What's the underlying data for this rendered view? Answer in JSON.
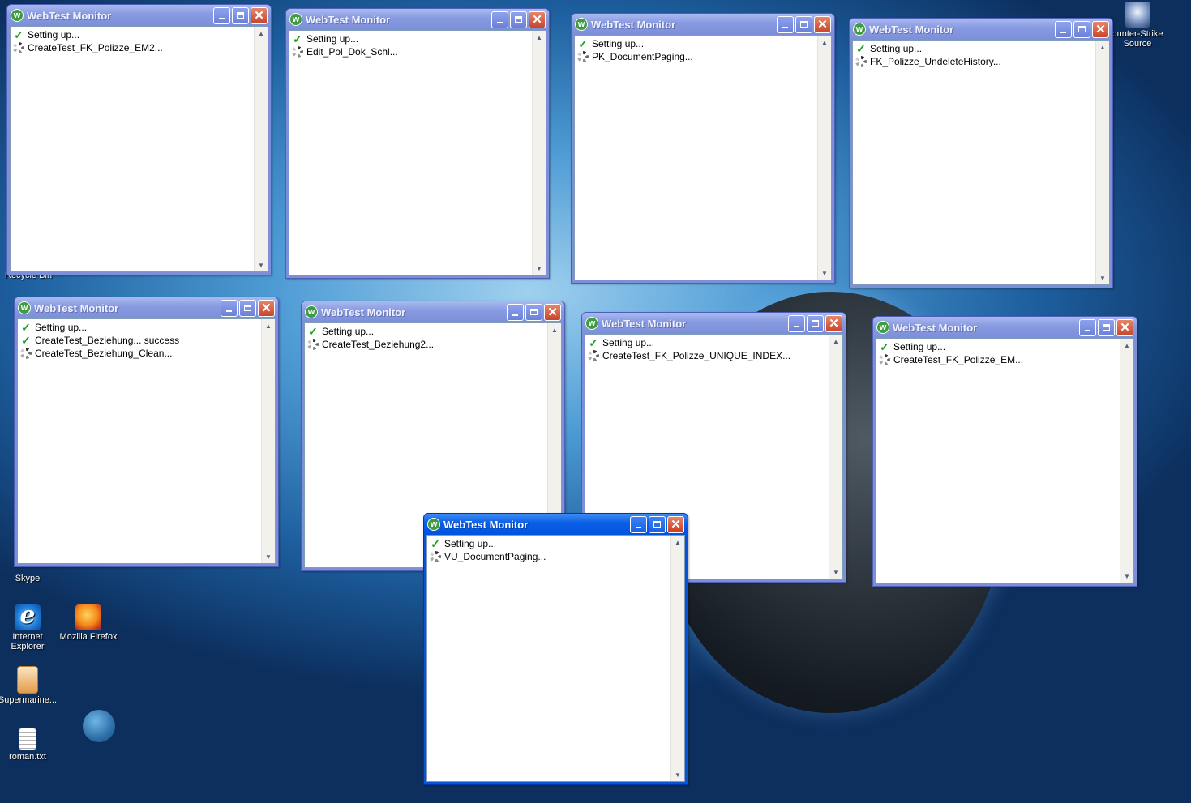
{
  "desktop": {
    "icons": [
      {
        "label": "Skype"
      },
      {
        "label": "Internet Explorer"
      },
      {
        "label": "Mozilla Firefox"
      },
      {
        "label": "Supermarine..."
      },
      {
        "label": "roman.txt"
      },
      {
        "label": "ounter-Strike Source"
      },
      {
        "label": "Recycle Bin"
      }
    ]
  },
  "windows": [
    {
      "title": "WebTest Monitor",
      "active": false,
      "rows": [
        {
          "status": "done",
          "text": "Setting up..."
        },
        {
          "status": "running",
          "text": "CreateTest_FK_Polizze_EM2..."
        }
      ]
    },
    {
      "title": "WebTest Monitor",
      "active": false,
      "rows": [
        {
          "status": "done",
          "text": "Setting up..."
        },
        {
          "status": "running",
          "text": "Edit_Pol_Dok_Schl..."
        }
      ]
    },
    {
      "title": "WebTest Monitor",
      "active": false,
      "rows": [
        {
          "status": "done",
          "text": "Setting up..."
        },
        {
          "status": "running",
          "text": "PK_DocumentPaging..."
        }
      ]
    },
    {
      "title": "WebTest Monitor",
      "active": false,
      "rows": [
        {
          "status": "done",
          "text": "Setting up..."
        },
        {
          "status": "running",
          "text": "FK_Polizze_UndeleteHistory..."
        }
      ]
    },
    {
      "title": "WebTest Monitor",
      "active": false,
      "rows": [
        {
          "status": "done",
          "text": "Setting up..."
        },
        {
          "status": "done",
          "text": "CreateTest_Beziehung... success"
        },
        {
          "status": "running",
          "text": "CreateTest_Beziehung_Clean..."
        }
      ]
    },
    {
      "title": "WebTest Monitor",
      "active": false,
      "rows": [
        {
          "status": "done",
          "text": "Setting up..."
        },
        {
          "status": "running",
          "text": "CreateTest_Beziehung2..."
        }
      ]
    },
    {
      "title": "WebTest Monitor",
      "active": false,
      "rows": [
        {
          "status": "done",
          "text": "Setting up..."
        },
        {
          "status": "running",
          "text": "CreateTest_FK_Polizze_UNIQUE_INDEX..."
        }
      ]
    },
    {
      "title": "WebTest Monitor",
      "active": false,
      "rows": [
        {
          "status": "done",
          "text": "Setting up..."
        },
        {
          "status": "running",
          "text": "CreateTest_FK_Polizze_EM..."
        }
      ]
    },
    {
      "title": "WebTest Monitor",
      "active": true,
      "rows": [
        {
          "status": "done",
          "text": "Setting up..."
        },
        {
          "status": "running",
          "text": "VU_DocumentPaging..."
        }
      ]
    }
  ]
}
